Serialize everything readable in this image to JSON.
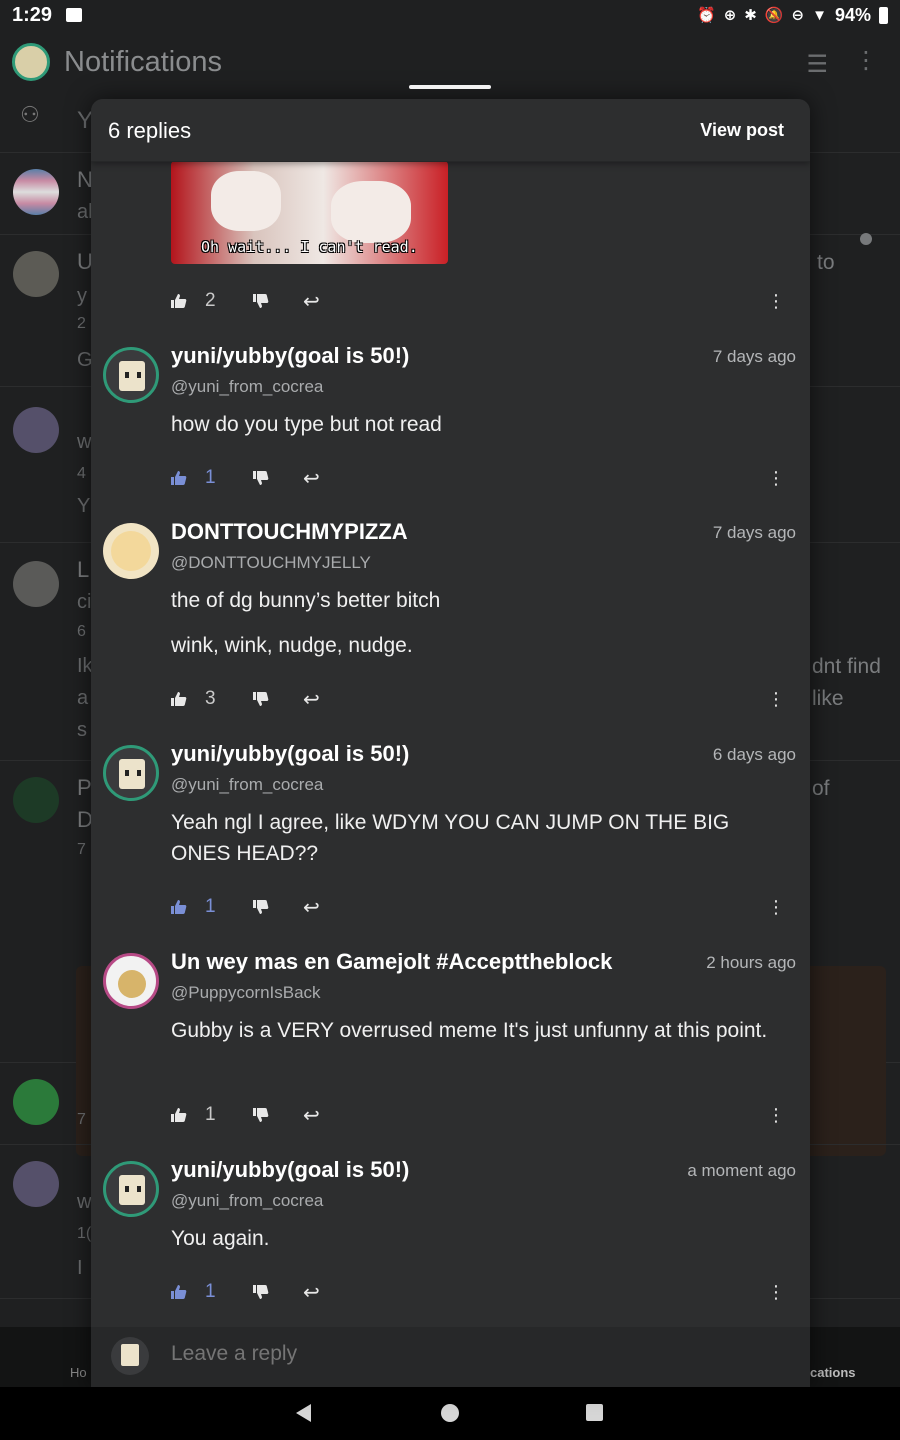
{
  "status_bar": {
    "time": "1:29",
    "battery": "94%"
  },
  "app": {
    "title": "Notifications",
    "filter_icon": "filter-icon",
    "more_icon": "more-vert-icon"
  },
  "background": {
    "rows": [
      {
        "line1": "Y"
      },
      {
        "line1": "N",
        "line2": "al"
      },
      {
        "line1": "U",
        "line2": "y",
        "line3": "2",
        "line4": "G",
        "side": "to"
      },
      {
        "line1": "w",
        "line2": "4",
        "line3": "Y"
      },
      {
        "line1": "L",
        "line2": "ci",
        "line3": "6",
        "line4": "Ik",
        "line5": "a",
        "line6": "s",
        "side1": "dnt find",
        "side2": "like"
      },
      {
        "line1": "P",
        "line2": "D",
        "line3": "7",
        "side": "of"
      },
      {
        "line1": "7"
      },
      {
        "line1": "w",
        "line2": "1(",
        "line3": "I"
      }
    ],
    "bottom_nav_left": "Ho",
    "bottom_nav_right": "cations"
  },
  "sheet": {
    "title": "6 replies",
    "view_post": "View post",
    "gif_caption": "Oh wait... I can't read.",
    "gif_actions": {
      "likes": "2"
    },
    "comments": [
      {
        "name": "yuni/yubby(goal is 50!)",
        "handle": "@yuni_from_cocrea",
        "time": "7 days ago",
        "body": [
          "how do you type but not read"
        ],
        "likes": "1",
        "liked": true
      },
      {
        "name": "DONTTOUCHMYPIZZA",
        "handle": "@DONTTOUCHMYJELLY",
        "time": "7 days ago",
        "body": [
          "the of dg bunny’s better bitch",
          "wink, wink, nudge, nudge."
        ],
        "likes": "3",
        "liked": false
      },
      {
        "name": "yuni/yubby(goal is 50!)",
        "handle": "@yuni_from_cocrea",
        "time": "6 days ago",
        "body": [
          "Yeah ngl I agree, like WDYM YOU CAN JUMP ON THE BIG ONES HEAD??"
        ],
        "likes": "1",
        "liked": true
      },
      {
        "name": "Un wey mas en Gamejolt #Accepttheblock",
        "handle": "@PuppycornIsBack",
        "time": "2 hours ago",
        "body": [
          "Gubby is a VERY overrused meme  It's just unfunny at this point."
        ],
        "likes": "1",
        "liked": false
      },
      {
        "name": "yuni/yubby(goal is 50!)",
        "handle": "@yuni_from_cocrea",
        "time": "a moment ago",
        "body": [
          "You again."
        ],
        "likes": "1",
        "liked": true
      }
    ],
    "reply_placeholder": "Leave a reply"
  },
  "colors": {
    "like_active": "#7a8fd6",
    "sheet_bg": "#2d2e2f",
    "page_bg": "#1f2021",
    "avatar_ring": "#2f9a78"
  }
}
